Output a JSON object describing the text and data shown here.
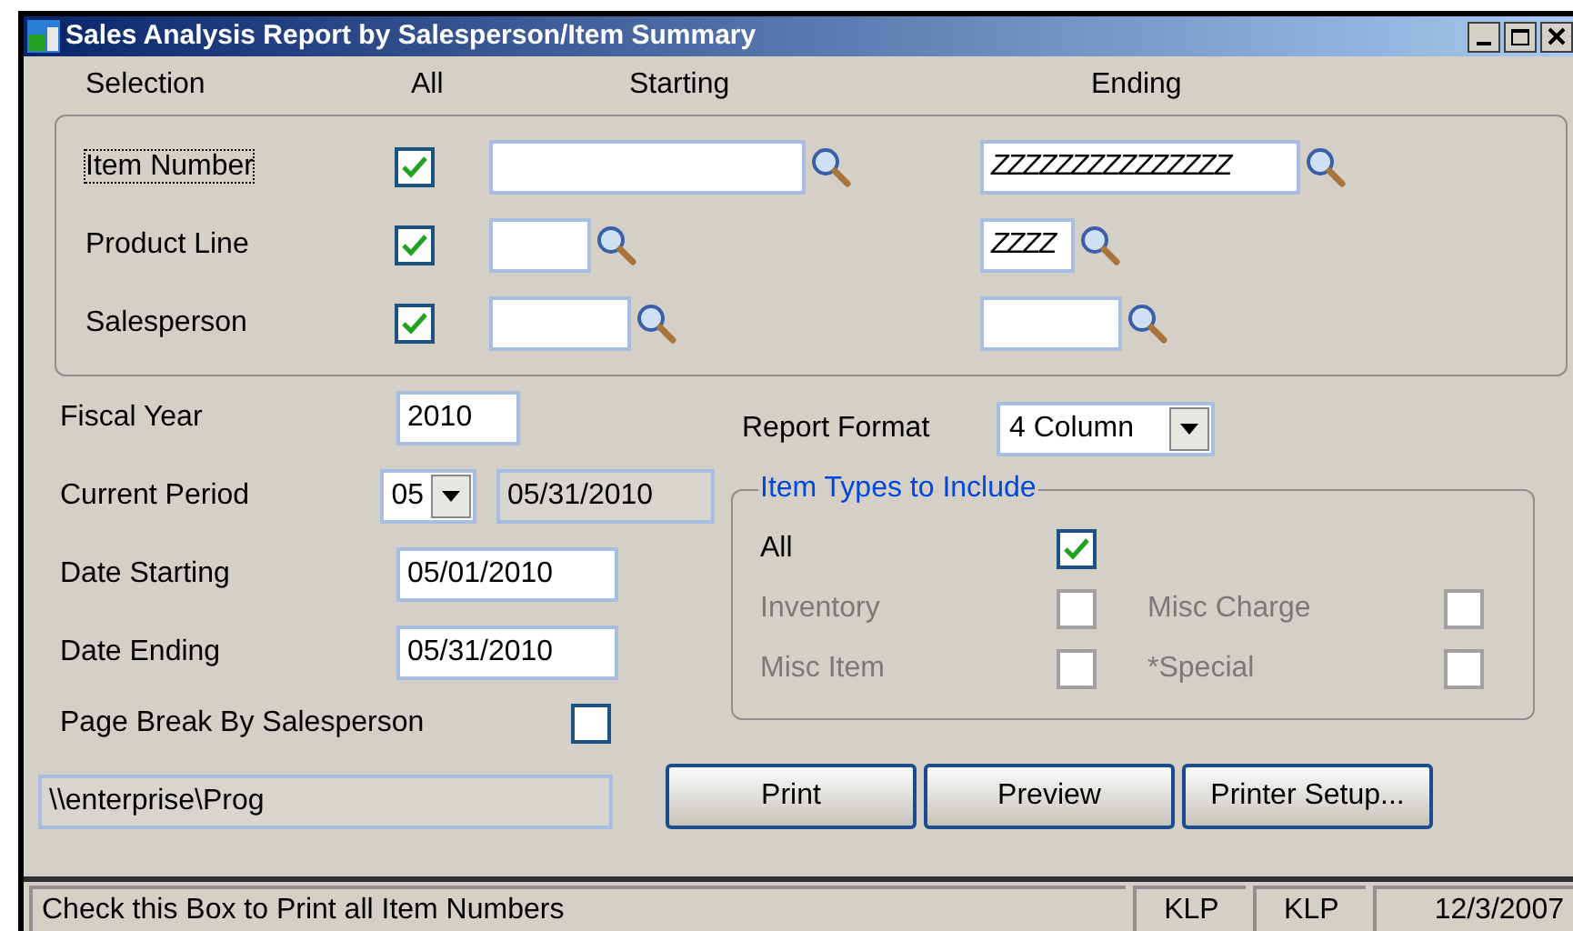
{
  "window": {
    "title": "Sales Analysis Report by Salesperson/Item Summary"
  },
  "selection": {
    "headers": [
      "Selection",
      "All",
      "Starting",
      "Ending"
    ],
    "rows": [
      {
        "label": "Item Number",
        "focused": true,
        "all_checked": true,
        "ending": "ZZZZZZZZZZZZZZZ"
      },
      {
        "label": "Product Line",
        "focused": false,
        "all_checked": true,
        "ending": "ZZZZ"
      },
      {
        "label": "Salesperson",
        "focused": false,
        "all_checked": true
      }
    ]
  },
  "fields": [
    {
      "kind": "text",
      "label": "Fiscal Year",
      "value": "2010"
    },
    {
      "kind": "period",
      "label": "Current Period",
      "value": "05",
      "display": "05/31/2010"
    },
    {
      "kind": "text",
      "label": "Date Starting",
      "value": "05/01/2010"
    },
    {
      "kind": "text",
      "label": "Date Ending",
      "value": "05/31/2010"
    },
    {
      "kind": "checkbox",
      "label": "Page Break By Salesperson",
      "checked": false
    }
  ],
  "path": "\\\\enterprise\\Prog",
  "report_format": {
    "label": "Report Format",
    "value": "4 Column"
  },
  "item_types": {
    "title": "Item Types to Include",
    "items": [
      {
        "label": "All",
        "checked": true,
        "disabled": false
      },
      {
        "label": "Inventory",
        "checked": false,
        "disabled": true
      },
      {
        "label": "Misc Charge",
        "checked": false,
        "disabled": true
      },
      {
        "label": "Misc Item",
        "checked": false,
        "disabled": true
      },
      {
        "label": "*Special",
        "checked": false,
        "disabled": true
      }
    ]
  },
  "buttons": [
    "Print",
    "Preview",
    "Printer Setup..."
  ],
  "status_bar": [
    "Check this Box to Print all Item Numbers",
    "KLP",
    "KLP",
    "12/3/2007"
  ]
}
